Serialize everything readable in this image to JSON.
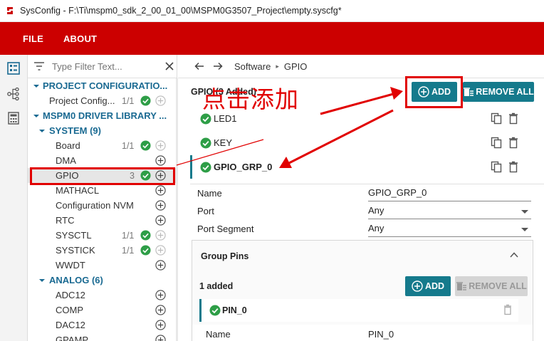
{
  "window": {
    "title": "SysConfig - F:\\Ti\\mspm0_sdk_2_00_01_00\\MSPM0G3507_Project\\empty.syscfg*"
  },
  "menu": {
    "file": "FILE",
    "about": "ABOUT"
  },
  "filter": {
    "placeholder": "Type Filter Text..."
  },
  "tree": {
    "project_configuration": "PROJECT CONFIGURATIO...",
    "project_config_item": {
      "label": "Project Config...",
      "count": "1/1"
    },
    "driver_library": "MSPM0 DRIVER LIBRARY ...",
    "system": "SYSTEM (9)",
    "system_items": [
      {
        "label": "Board",
        "count": "1/1"
      },
      {
        "label": "DMA",
        "count": ""
      },
      {
        "label": "GPIO",
        "count": "3"
      },
      {
        "label": "MATHACL",
        "count": ""
      },
      {
        "label": "Configuration NVM",
        "count": ""
      },
      {
        "label": "RTC",
        "count": ""
      },
      {
        "label": "SYSCTL",
        "count": "1/1"
      },
      {
        "label": "SYSTICK",
        "count": "1/1"
      },
      {
        "label": "WWDT",
        "count": ""
      }
    ],
    "analog": "ANALOG (6)",
    "analog_items": [
      {
        "label": "ADC12"
      },
      {
        "label": "COMP"
      },
      {
        "label": "DAC12"
      },
      {
        "label": "GPAMP"
      }
    ]
  },
  "breadcrumb": {
    "software": "Software",
    "separator": "▸",
    "gpio": "GPIO"
  },
  "module": {
    "header": "GPIO (3 Added)",
    "add_label": "ADD",
    "remove_all_label": "REMOVE ALL",
    "instances": [
      "LED1",
      "KEY",
      "GPIO_GRP_0"
    ]
  },
  "fields": {
    "name": {
      "label": "Name",
      "value": "GPIO_GRP_0"
    },
    "port": {
      "label": "Port",
      "value": "Any"
    },
    "port_segment": {
      "label": "Port Segment",
      "value": "Any"
    }
  },
  "group_pins": {
    "title": "Group Pins",
    "added": "1 added",
    "add_label": "ADD",
    "remove_all_label": "REMOVE ALL",
    "pin": "PIN_0",
    "name_label": "Name",
    "name_value": "PIN_0"
  },
  "annotation": {
    "text": "点击添加"
  },
  "colors": {
    "menubar": "#cc0000",
    "teal": "#157a8c",
    "check": "#2e9e47",
    "annot": "#e10000"
  }
}
